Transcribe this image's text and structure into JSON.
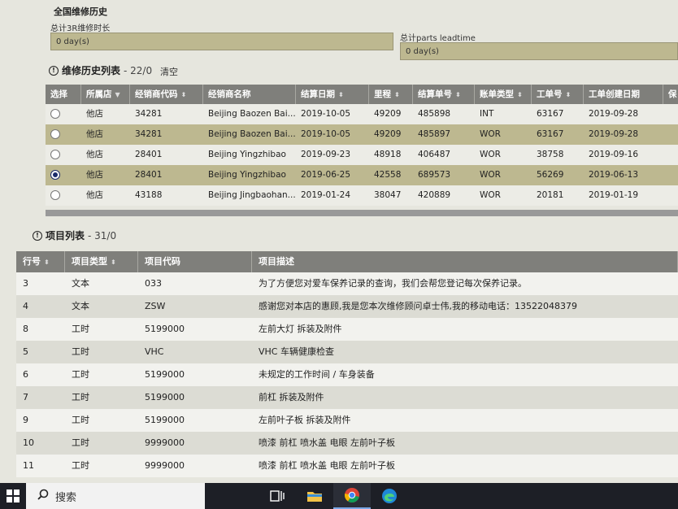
{
  "header": {
    "title": "全国维修历史",
    "summary_3r_label": "总计3R维修时长",
    "summary_3r_value": "0 day(s)",
    "summary_parts_label": "总计parts leadtime",
    "summary_parts_value": "0 day(s)"
  },
  "history": {
    "heading": "维修历史列表",
    "count": "- 22/0",
    "clear_label": "清空",
    "columns": [
      "选择",
      "所属店",
      "经销商代码",
      "经销商名称",
      "结算日期",
      "里程",
      "结算单号",
      "账单类型",
      "工单号",
      "工单创建日期",
      "保"
    ],
    "rows": [
      {
        "selected": false,
        "store": "他店",
        "dealer_code": "34281",
        "dealer_name": "Beijing Baozen Bai...",
        "settle_date": "2019-10-05",
        "mileage": "49209",
        "settle_no": "485898",
        "bill_type": "INT",
        "order_no": "63167",
        "order_date": "2019-09-28"
      },
      {
        "selected": false,
        "store": "他店",
        "dealer_code": "34281",
        "dealer_name": "Beijing Baozen Bai...",
        "settle_date": "2019-10-05",
        "mileage": "49209",
        "settle_no": "485897",
        "bill_type": "WOR",
        "order_no": "63167",
        "order_date": "2019-09-28"
      },
      {
        "selected": false,
        "store": "他店",
        "dealer_code": "28401",
        "dealer_name": "Beijing Yingzhibao",
        "settle_date": "2019-09-23",
        "mileage": "48918",
        "settle_no": "406487",
        "bill_type": "WOR",
        "order_no": "38758",
        "order_date": "2019-09-16"
      },
      {
        "selected": true,
        "store": "他店",
        "dealer_code": "28401",
        "dealer_name": "Beijing Yingzhibao",
        "settle_date": "2019-06-25",
        "mileage": "42558",
        "settle_no": "689573",
        "bill_type": "WOR",
        "order_no": "56269",
        "order_date": "2019-06-13"
      },
      {
        "selected": false,
        "store": "他店",
        "dealer_code": "43188",
        "dealer_name": "Beijing Jingbaohan...",
        "settle_date": "2019-01-24",
        "mileage": "38047",
        "settle_no": "420889",
        "bill_type": "WOR",
        "order_no": "20181",
        "order_date": "2019-01-19"
      }
    ]
  },
  "items": {
    "heading": "项目列表",
    "count": "- 31/0",
    "columns": [
      "行号",
      "项目类型",
      "项目代码",
      "项目描述"
    ],
    "rows": [
      {
        "line": "3",
        "type": "文本",
        "code": "033",
        "desc": "为了方便您对爱车保养记录的查询，我们会帮您登记每次保养记录。"
      },
      {
        "line": "4",
        "type": "文本",
        "code": "ZSW",
        "desc": "感谢您对本店的惠顾,我是您本次维修顾问卓士伟,我的移动电话：13522048379"
      },
      {
        "line": "8",
        "type": "工时",
        "code": "5199000",
        "desc": "左前大灯 拆装及附件"
      },
      {
        "line": "5",
        "type": "工时",
        "code": "VHC",
        "desc": "VHC 车辆健康检查"
      },
      {
        "line": "6",
        "type": "工时",
        "code": "5199000",
        "desc": "未规定的工作时间 / 车身装备"
      },
      {
        "line": "7",
        "type": "工时",
        "code": "5199000",
        "desc": "前杠 拆装及附件"
      },
      {
        "line": "9",
        "type": "工时",
        "code": "5199000",
        "desc": "左前叶子板 拆装及附件"
      },
      {
        "line": "10",
        "type": "工时",
        "code": "9999000",
        "desc": "喷漆 前杠 喷水盖 电眼 左前叶子板"
      },
      {
        "line": "11",
        "type": "工时",
        "code": "9999000",
        "desc": "喷漆 前杠 喷水盖 电眼 左前叶子板"
      }
    ]
  },
  "taskbar": {
    "search_placeholder": "搜索",
    "icons": [
      "windows-start-icon",
      "search-icon",
      "task-view-icon",
      "file-explorer-icon",
      "chrome-icon",
      "edge-icon"
    ]
  },
  "colors": {
    "row_highlight": "#bdb890",
    "header_bg": "#7f7f7b",
    "radio_selected": "#1a2a6a"
  }
}
